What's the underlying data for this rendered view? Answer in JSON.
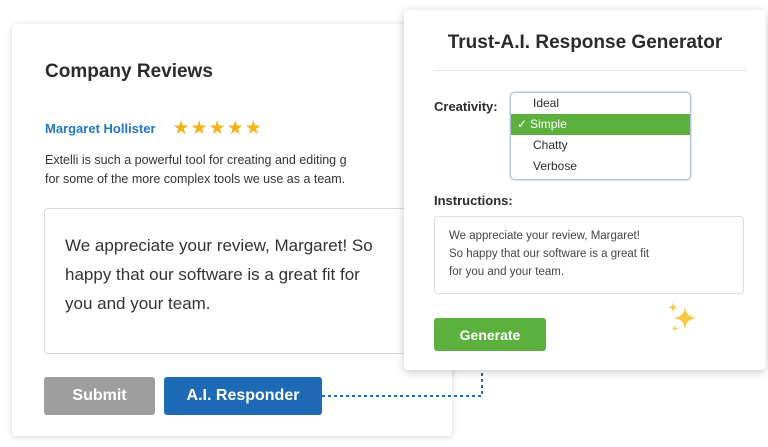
{
  "reviews": {
    "title": "Company Reviews",
    "reviewer_name": "Margaret Hollister",
    "rating": 5,
    "review_line1": "Extelli is such a powerful tool for creating and editing g",
    "review_line2": "for some of the more complex tools we use as a team.",
    "response_line1": "We appreciate your review, Margaret! So",
    "response_line2": "happy that our software is a great fit for",
    "response_line3": "you and your team.",
    "submit_label": "Submit",
    "ai_responder_label": "A.I. Responder"
  },
  "generator": {
    "title": "Trust-A.I. Response Generator",
    "creativity_label": "Creativity:",
    "options": [
      "Ideal",
      "Simple",
      "Chatty",
      "Verbose"
    ],
    "selected_option": "Simple",
    "instructions_label": "Instructions:",
    "instructions_line1": "We appreciate your review, Margaret!",
    "instructions_line2": "So happy that our software is a great fit",
    "instructions_line3": "for you and your team.",
    "generate_label": "Generate"
  },
  "colors": {
    "accent_blue": "#1f6ab5",
    "link_blue": "#1f78c1",
    "green": "#5cb03e",
    "star": "#f2b21b",
    "submit_gray": "#9e9e9e"
  },
  "icons": [
    "star-icon",
    "checkmark-icon",
    "sparkle-icon"
  ]
}
